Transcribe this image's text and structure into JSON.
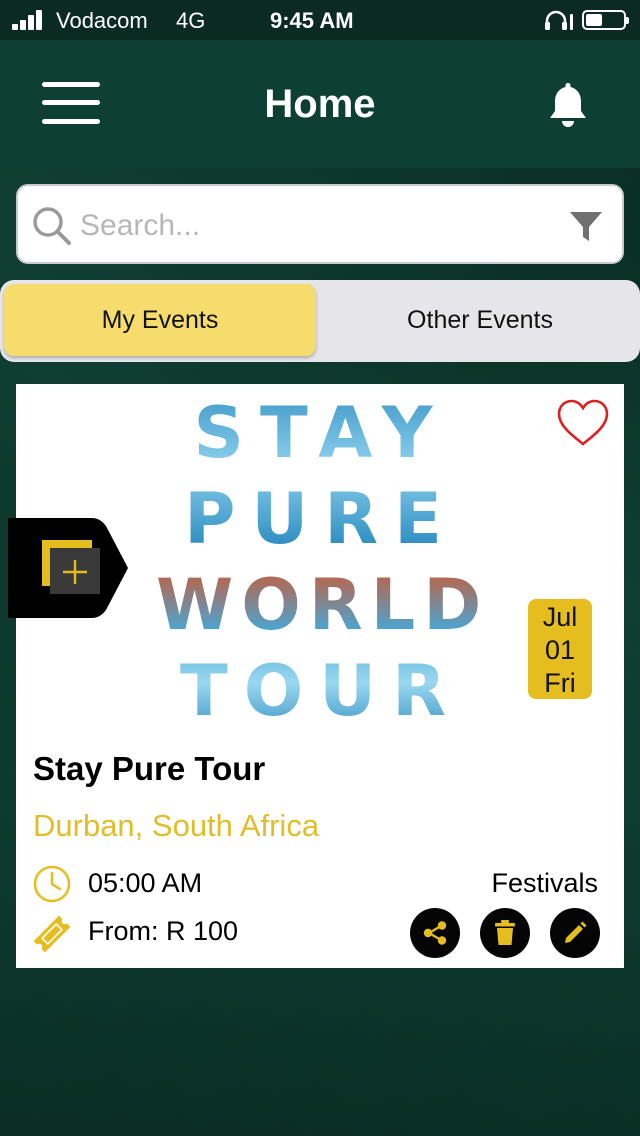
{
  "status_bar": {
    "carrier": "Vodacom",
    "network": "4G",
    "time": "9:45 AM"
  },
  "header": {
    "title": "Home",
    "menu_icon": "hamburger-menu-icon",
    "notification_icon": "bell-icon"
  },
  "search": {
    "placeholder": "Search...",
    "value": "",
    "search_icon": "search-icon",
    "filter_icon": "filter-icon"
  },
  "tabs": [
    {
      "label": "My Events",
      "active": true
    },
    {
      "label": "Other Events",
      "active": false
    }
  ],
  "event": {
    "poster_lines": [
      "STAY",
      "PURE",
      "WORLD",
      "TOUR"
    ],
    "date": {
      "month": "Jul",
      "day": "01",
      "weekday": "Fri"
    },
    "title": "Stay Pure Tour",
    "location": "Durban, South Africa",
    "time": "05:00 AM",
    "price": "From: R 100",
    "category": "Festivals",
    "favorite": false
  },
  "colors": {
    "header_bg": "#0d3f33",
    "accent_yellow": "#e6bd1f",
    "active_tab": "#f5dc6c",
    "location_text": "#e2bd2a",
    "heart": "#e02020"
  }
}
